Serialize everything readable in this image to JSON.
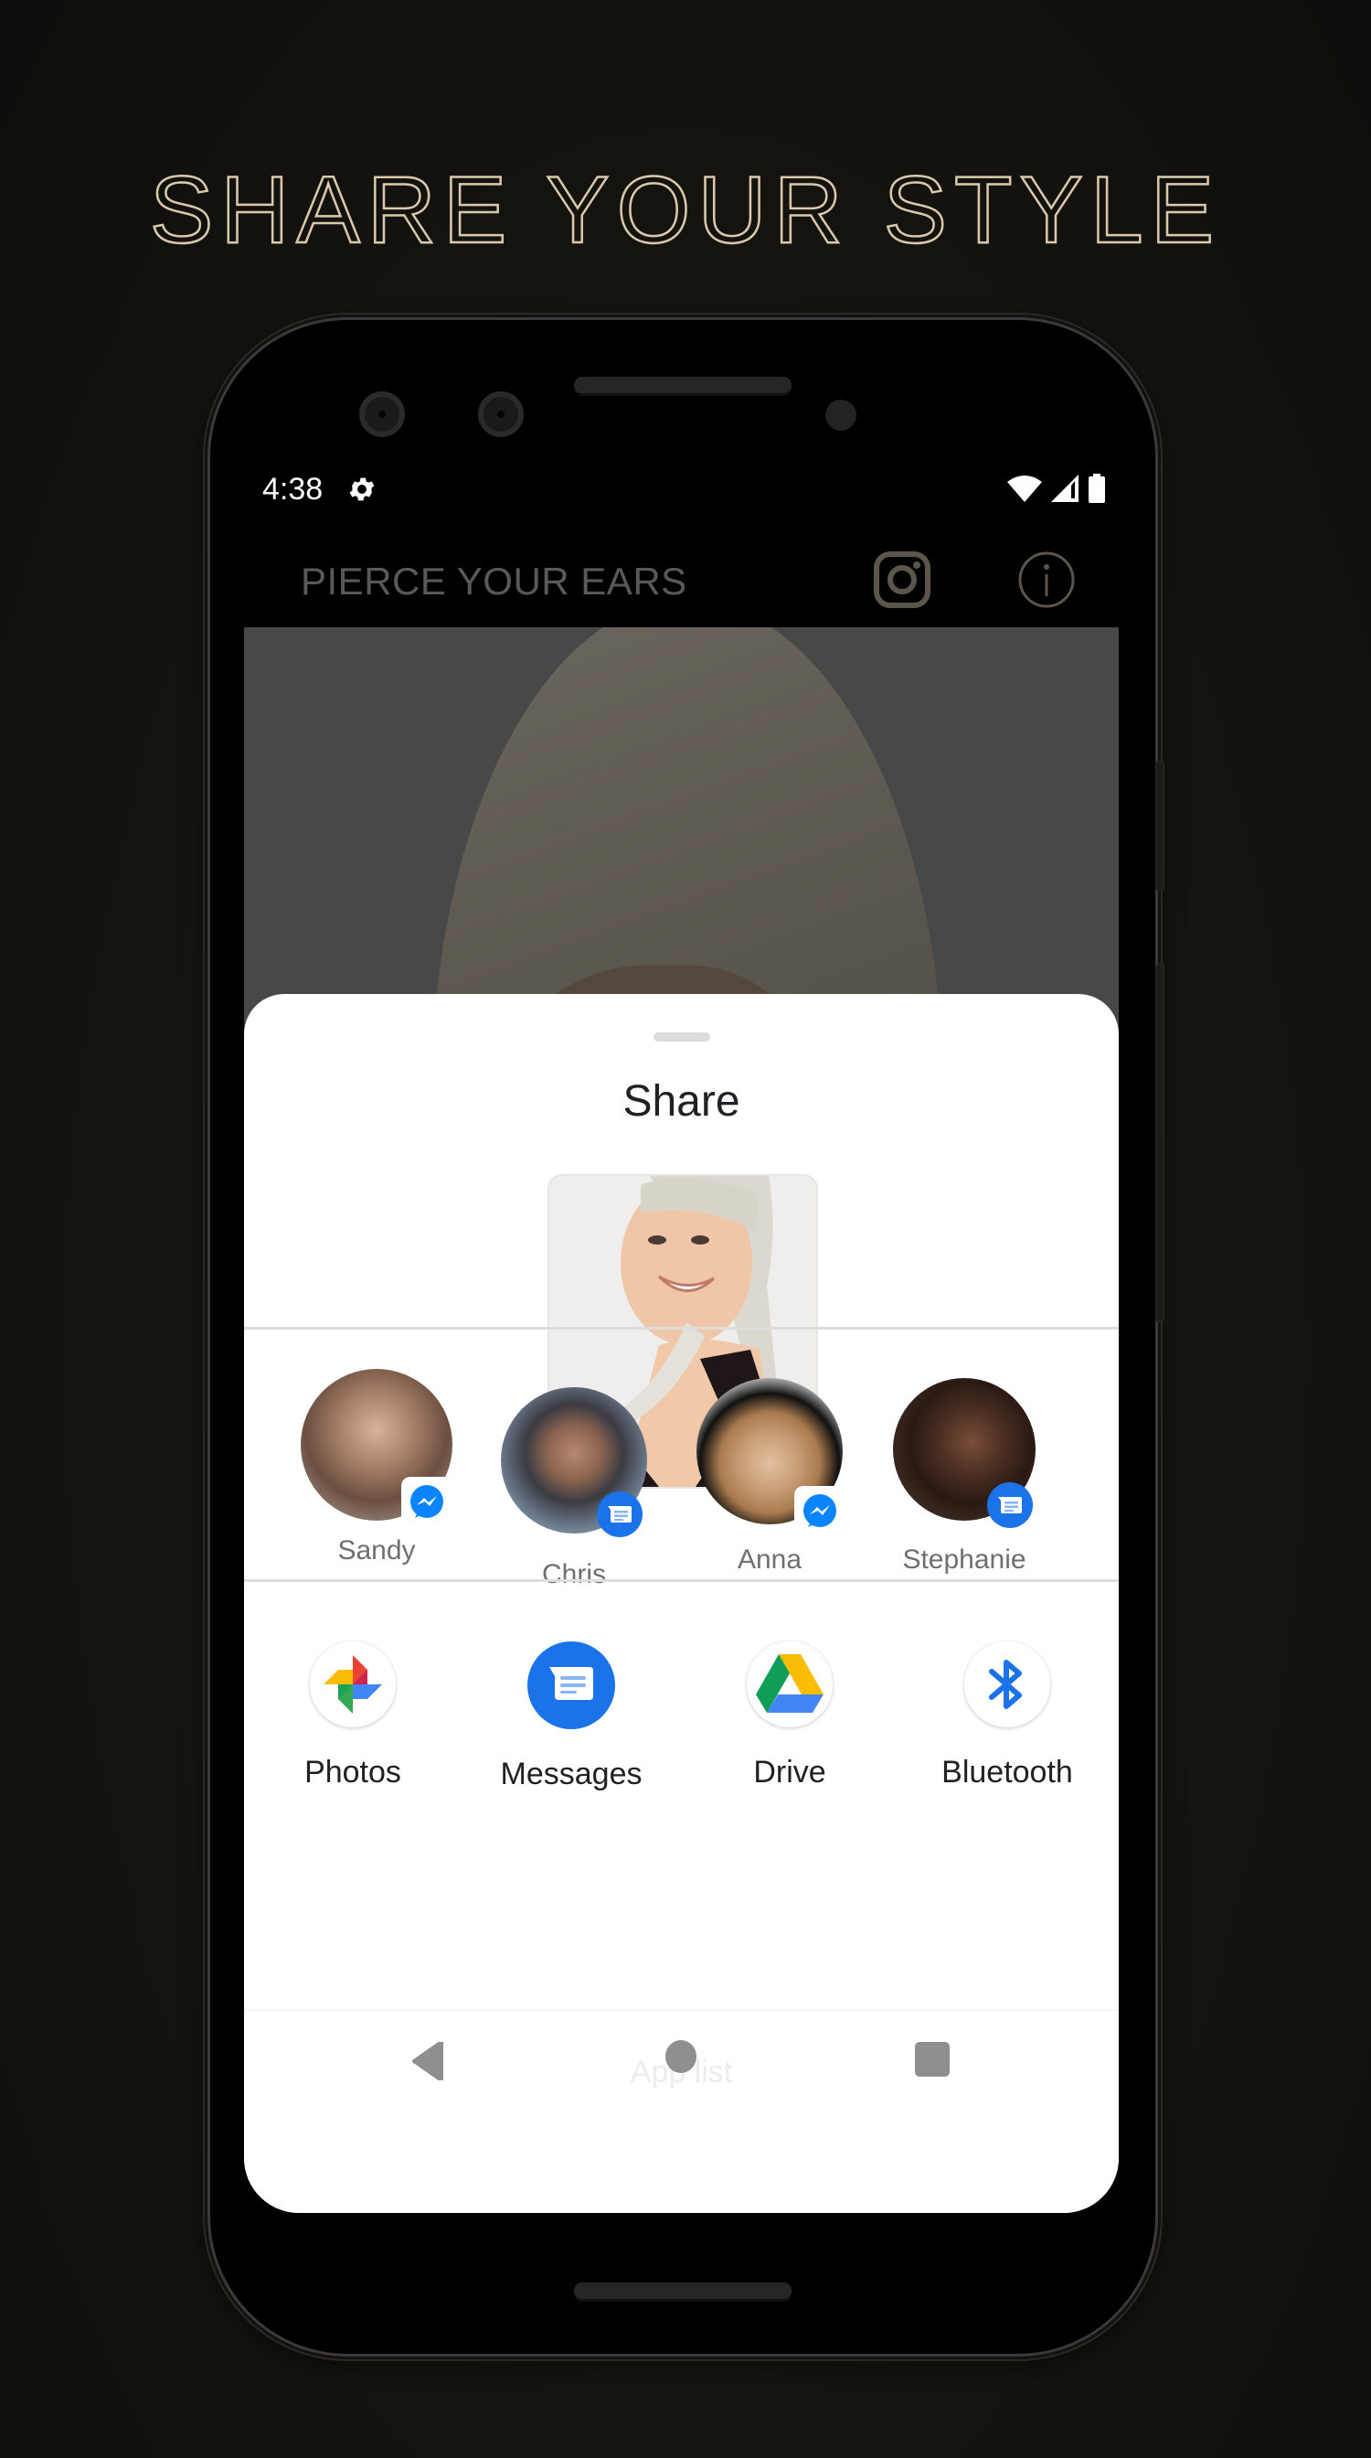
{
  "promo": {
    "headline": "SHARE YOUR STYLE"
  },
  "status_bar": {
    "time": "4:38",
    "icons": [
      "settings-gear-icon",
      "wifi-icon",
      "cell-signal-icon",
      "battery-icon"
    ]
  },
  "app_bar": {
    "title": "PIERCE YOUR EARS",
    "actions": [
      {
        "name": "instagram",
        "icon": "instagram-icon"
      },
      {
        "name": "info",
        "icon": "info-icon"
      }
    ],
    "icon_color": "#5b554b"
  },
  "share_sheet": {
    "title": "Share",
    "preview_alt": "Smiling woman with platinum ponytail",
    "direct_share": [
      {
        "name": "Sandy",
        "via": "Messenger"
      },
      {
        "name": "Chris",
        "via": "Messages"
      },
      {
        "name": "Anna",
        "via": "Messenger"
      },
      {
        "name": "Stephanie",
        "via": "Messages"
      }
    ],
    "apps": [
      {
        "label": "Photos",
        "icon": "google-photos-icon"
      },
      {
        "label": "Messages",
        "icon": "messages-icon"
      },
      {
        "label": "Drive",
        "icon": "google-drive-icon"
      },
      {
        "label": "Bluetooth",
        "icon": "bluetooth-icon"
      }
    ],
    "app_list_label": "App list"
  },
  "nav_bar": {
    "buttons": [
      "back",
      "home",
      "recents"
    ]
  },
  "colors": {
    "headline": "#d9c9ad",
    "accent_blue": "#1a73e8",
    "messenger_blue": "#0084ff",
    "sheet_bg": "#ffffff",
    "scrim": "#484848"
  }
}
